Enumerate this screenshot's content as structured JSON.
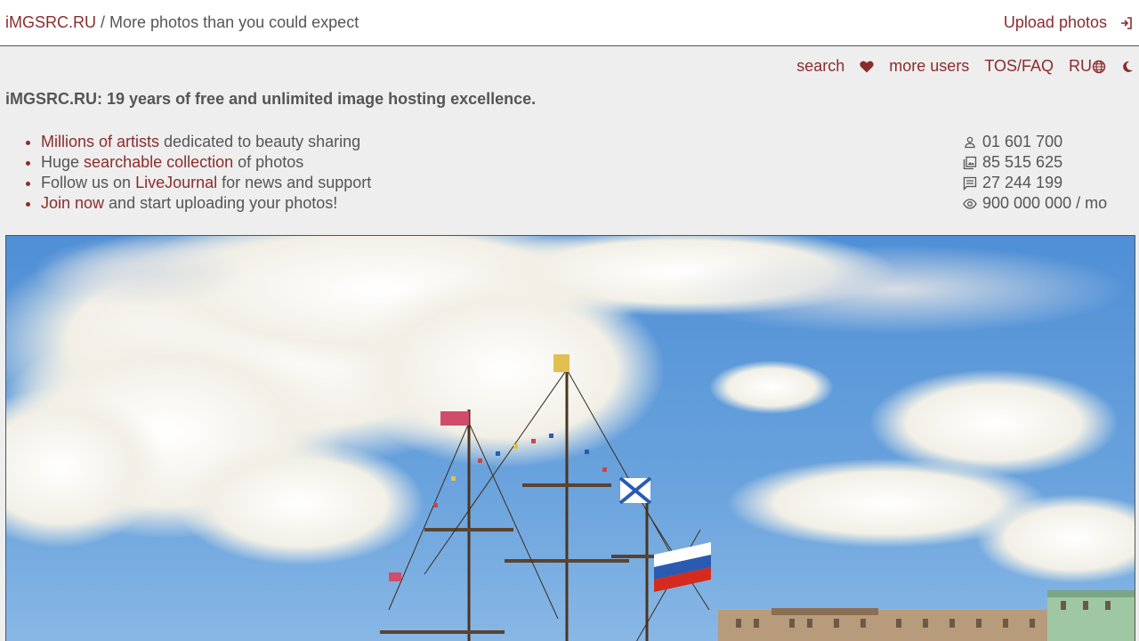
{
  "topbar": {
    "brand": "iMGSRC.RU",
    "separator": "/",
    "tagline": "More photos than you could expect",
    "upload_label": "Upload photos",
    "login_icon": "login-icon"
  },
  "nav": {
    "search": "search",
    "favorites_icon": "heart-icon",
    "more_users": "more users",
    "tos": "TOS/FAQ",
    "language": "RU",
    "language_icon": "globe-icon",
    "theme_icon": "moon-icon"
  },
  "heading": "iMGSRC.RU: 19 years of free and unlimited image hosting excellence.",
  "features": [
    {
      "link": "Millions of artists",
      "pre": "",
      "post": " dedicated to beauty sharing"
    },
    {
      "link": "searchable collection",
      "pre": "Huge ",
      "post": " of photos"
    },
    {
      "link": "LiveJournal",
      "pre": "Follow us on ",
      "post": " for news and support"
    },
    {
      "link": "Join now",
      "pre": "",
      "post": " and start uploading your photos!"
    }
  ],
  "stats": {
    "users": "01 601 700",
    "photos": "85 515 625",
    "comments": "27 244 199",
    "views": "900 000 000 / mo"
  },
  "colors": {
    "accent": "#8b2c2c",
    "background": "#eeeeee",
    "text": "#555555"
  }
}
